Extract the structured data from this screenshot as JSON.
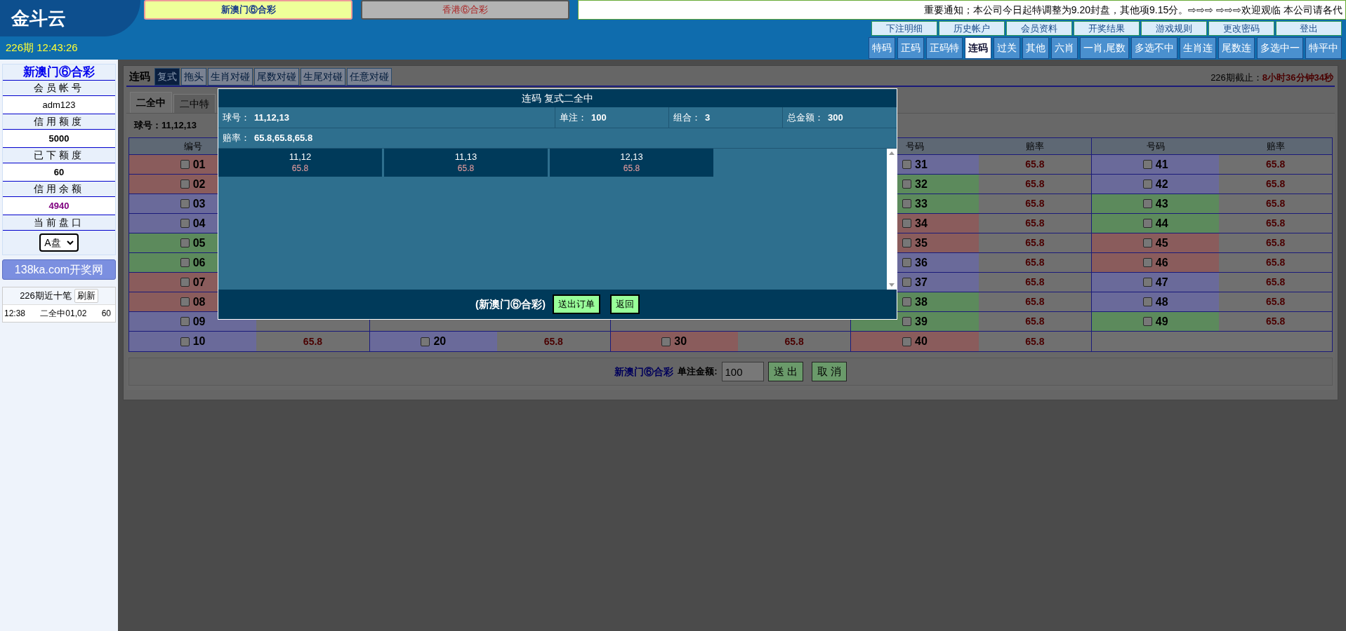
{
  "header": {
    "logo": "金斗云",
    "period_time": "226期 12:43:26",
    "lottery_tabs": [
      {
        "label": "新澳门⑥合彩",
        "selected": true
      },
      {
        "label": "香港⑥合彩",
        "selected": false
      }
    ],
    "notice": "重要通知；本公司今日起特调整为9.20封盘，其他项9.15分。⇨⇨⇨ ⇨⇨⇨欢迎观临 本公司请各代",
    "links": [
      "下注明细",
      "历史帐户",
      "会员资料",
      "开奖结果",
      "游戏规则",
      "更改密码",
      "登出"
    ],
    "game_tabs": [
      {
        "label": "特码",
        "selected": false
      },
      {
        "label": "正码",
        "selected": false
      },
      {
        "label": "正码特",
        "selected": false
      },
      {
        "label": "连码",
        "selected": true
      },
      {
        "label": "过关",
        "selected": false
      },
      {
        "label": "其他",
        "selected": false
      },
      {
        "label": "六肖",
        "selected": false
      },
      {
        "label": "一肖,尾数",
        "selected": false
      },
      {
        "label": "多选不中",
        "selected": false
      },
      {
        "label": "生肖连",
        "selected": false
      },
      {
        "label": "尾数连",
        "selected": false
      },
      {
        "label": "多选中一",
        "selected": false
      },
      {
        "label": "特平中",
        "selected": false
      }
    ]
  },
  "sidebar": {
    "title": "新澳门⑥合彩",
    "fields": [
      {
        "label": "会员帐号",
        "value": "adm123",
        "kind": "plain"
      },
      {
        "label": "信用额度",
        "value": "5000",
        "kind": "bold"
      },
      {
        "label": "已下额度",
        "value": "60",
        "kind": "bold"
      },
      {
        "label": "信用余额",
        "value": "4940",
        "kind": "highlight"
      }
    ],
    "market_label": "当前盘口",
    "market_value": "A盘",
    "site_button": "138ka.com开奖网",
    "recent_title": "226期近十笔",
    "refresh_button": "刷新",
    "recent_bets": [
      {
        "time": "12:38",
        "content": "二全中01,02",
        "amount": "60"
      }
    ]
  },
  "main": {
    "section_title": "连码",
    "mode_tabs": [
      {
        "label": "复式",
        "selected": true
      },
      {
        "label": "拖头",
        "selected": false
      },
      {
        "label": "生肖对碰",
        "selected": false
      },
      {
        "label": "尾数对碰",
        "selected": false
      },
      {
        "label": "生尾对碰",
        "selected": false
      },
      {
        "label": "任意对碰",
        "selected": false
      }
    ],
    "deadline_label": "226期截止：",
    "deadline_value": "8小时36分钟34秒",
    "play_tabs": [
      {
        "label": "二全中",
        "selected": true
      },
      {
        "label": "二中特",
        "selected": false
      }
    ],
    "balls_label": "球号：11,12,13",
    "groups": [
      {
        "number_header": "编号",
        "rows": [
          {
            "number": "01",
            "color": "#8a5c5c",
            "checked": false
          },
          {
            "number": "02",
            "color": "#8a5c5c",
            "checked": false
          },
          {
            "number": "03",
            "color": "#6a6a9a",
            "checked": false
          },
          {
            "number": "04",
            "color": "#6a6a9a",
            "checked": false
          },
          {
            "number": "05",
            "color": "#5c8a5c",
            "checked": false
          },
          {
            "number": "06",
            "color": "#5c8a5c",
            "checked": false
          },
          {
            "number": "07",
            "color": "#8a5c5c",
            "checked": false
          },
          {
            "number": "08",
            "color": "#8a5c5c",
            "checked": false
          },
          {
            "number": "09",
            "color": "#6a6a9a",
            "checked": false
          },
          {
            "number": "10",
            "color": "#6a6a9a",
            "checked": false,
            "odds": "65.8"
          }
        ]
      },
      {
        "rows": [
          {
            "number": "20",
            "color": "#6a6a9a",
            "checked": false,
            "odds": "65.8"
          }
        ]
      },
      {
        "rows": [
          {
            "number": "30",
            "color": "#8a5c5c",
            "checked": false,
            "odds": "65.8"
          }
        ]
      },
      {
        "number_header": "号码",
        "odds_header": "赔率",
        "rows": [
          {
            "number": "31",
            "color": "#6a6a9a",
            "checked": false,
            "odds": "65.8"
          },
          {
            "number": "32",
            "color": "#5c8a5c",
            "checked": false,
            "odds": "65.8"
          },
          {
            "number": "33",
            "color": "#5c8a5c",
            "checked": false,
            "odds": "65.8"
          },
          {
            "number": "34",
            "color": "#8a5c5c",
            "checked": false,
            "odds": "65.8"
          },
          {
            "number": "35",
            "color": "#8a5c5c",
            "checked": false,
            "odds": "65.8"
          },
          {
            "number": "36",
            "color": "#6a6a9a",
            "checked": false,
            "odds": "65.8"
          },
          {
            "number": "37",
            "color": "#6a6a9a",
            "checked": false,
            "odds": "65.8"
          },
          {
            "number": "38",
            "color": "#5c8a5c",
            "checked": false,
            "odds": "65.8"
          },
          {
            "number": "39",
            "color": "#5c8a5c",
            "checked": false,
            "odds": "65.8"
          },
          {
            "number": "40",
            "color": "#8a5c5c",
            "checked": false,
            "odds": "65.8"
          }
        ]
      },
      {
        "number_header": "号码",
        "odds_header": "赔率",
        "rows": [
          {
            "number": "41",
            "color": "#6a6a9a",
            "checked": false,
            "odds": "65.8"
          },
          {
            "number": "42",
            "color": "#6a6a9a",
            "checked": false,
            "odds": "65.8"
          },
          {
            "number": "43",
            "color": "#5c8a5c",
            "checked": false,
            "odds": "65.8"
          },
          {
            "number": "44",
            "color": "#5c8a5c",
            "checked": false,
            "odds": "65.8"
          },
          {
            "number": "45",
            "color": "#8a5c5c",
            "checked": false,
            "odds": "65.8"
          },
          {
            "number": "46",
            "color": "#8a5c5c",
            "checked": false,
            "odds": "65.8"
          },
          {
            "number": "47",
            "color": "#6a6a9a",
            "checked": false,
            "odds": "65.8"
          },
          {
            "number": "48",
            "color": "#6a6a9a",
            "checked": false,
            "odds": "65.8"
          },
          {
            "number": "49",
            "color": "#5c8a5c",
            "checked": false,
            "odds": "65.8"
          }
        ]
      }
    ],
    "footer": {
      "lottery": "新澳门⑥合彩",
      "amount_label": "单注金额:",
      "amount_value": "100",
      "submit_button": "送 出",
      "cancel_button": "取 消"
    }
  },
  "dialog": {
    "title": "连码 复式二全中",
    "info": [
      {
        "label": "球号：",
        "value": "11,12,13"
      },
      {
        "label": "单注：",
        "value": "100"
      },
      {
        "label": "组合：",
        "value": "3"
      },
      {
        "label": "总金额：",
        "value": "300"
      }
    ],
    "odds_label": "赔率：",
    "odds_value": "65.8,65.8,65.8",
    "combos": [
      {
        "numbers": "11,12",
        "odds": "65.8"
      },
      {
        "numbers": "11,13",
        "odds": "65.8"
      },
      {
        "numbers": "12,13",
        "odds": "65.8"
      }
    ],
    "lottery": "(新澳门⑥合彩)",
    "submit_button": "送出订单",
    "back_button": "返回"
  }
}
